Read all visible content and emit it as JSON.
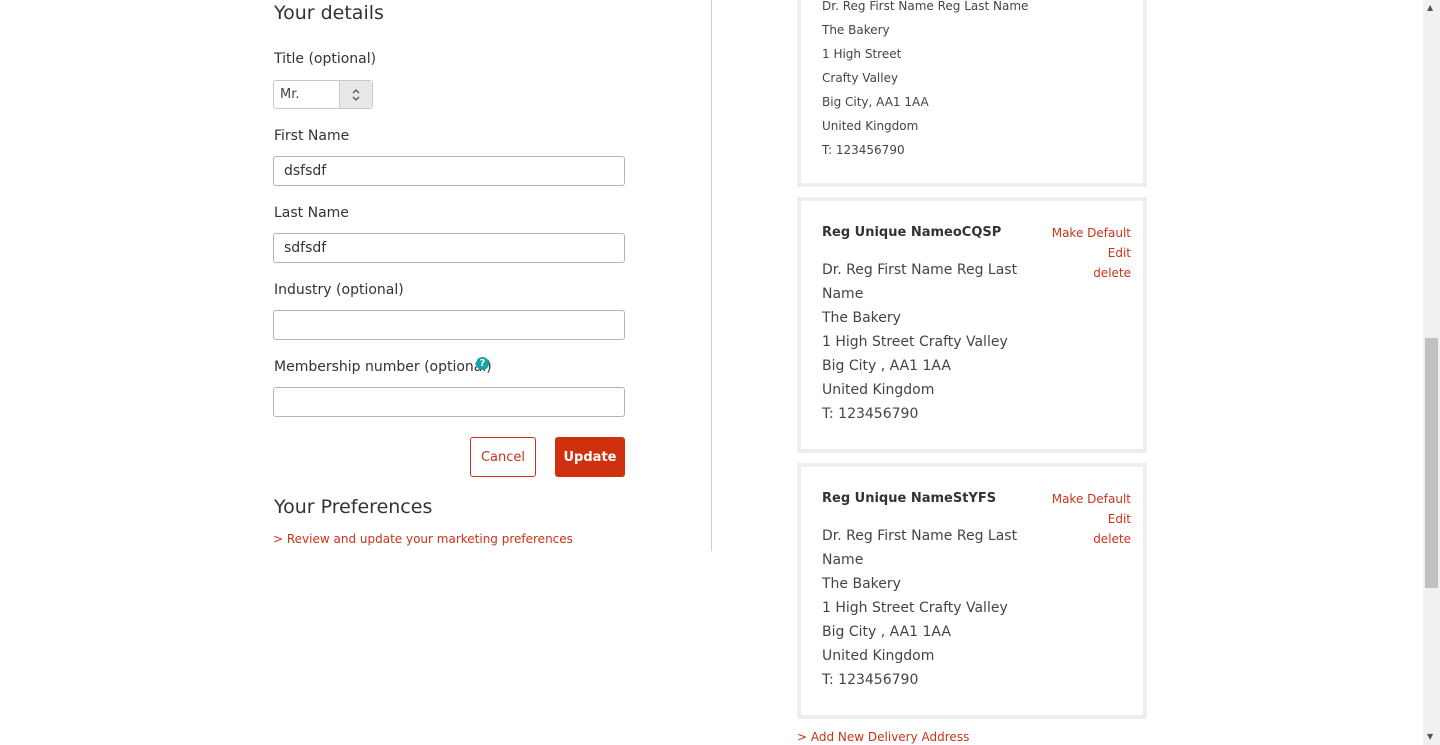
{
  "details": {
    "heading": "Your details",
    "title_label": "Title (optional)",
    "title_value": "Mr.",
    "first_name_label": "First Name",
    "first_name_value": "dsfsdf",
    "last_name_label": "Last Name",
    "last_name_value": "sdfsdf",
    "industry_label": "Industry (optional)",
    "industry_value": "",
    "membership_label": "Membership number (optional)",
    "membership_value": "",
    "help_symbol": "?",
    "cancel_label": "Cancel",
    "update_label": "Update"
  },
  "preferences": {
    "heading": "Your Preferences",
    "link": "> Review and update your marketing preferences"
  },
  "addresses": {
    "top_card": {
      "lines": [
        "Dr. Reg First Name Reg Last Name",
        "The Bakery",
        "1 High Street",
        "Crafty Valley",
        "Big City, AA1 1AA",
        "United Kingdom",
        "T: 123456790"
      ]
    },
    "cards": [
      {
        "name": "Reg Unique NameoCQSP",
        "make_default": "Make Default",
        "edit": "Edit",
        "delete": "delete",
        "lines": [
          "Dr. Reg First Name Reg Last Name",
          "The Bakery",
          "1 High Street Crafty Valley",
          "Big City , AA1 1AA",
          "United Kingdom",
          "T: 123456790"
        ]
      },
      {
        "name": "Reg Unique NameStYFS",
        "make_default": "Make Default",
        "edit": "Edit",
        "delete": "delete",
        "lines": [
          "Dr. Reg First Name Reg Last Name",
          "The Bakery",
          "1 High Street Crafty Valley",
          "Big City , AA1 1AA",
          "United Kingdom",
          "T: 123456790"
        ]
      }
    ],
    "add_link": "> Add New Delivery Address"
  },
  "colors": {
    "accent": "#cf300e",
    "help_icon": "#17a2a7"
  }
}
